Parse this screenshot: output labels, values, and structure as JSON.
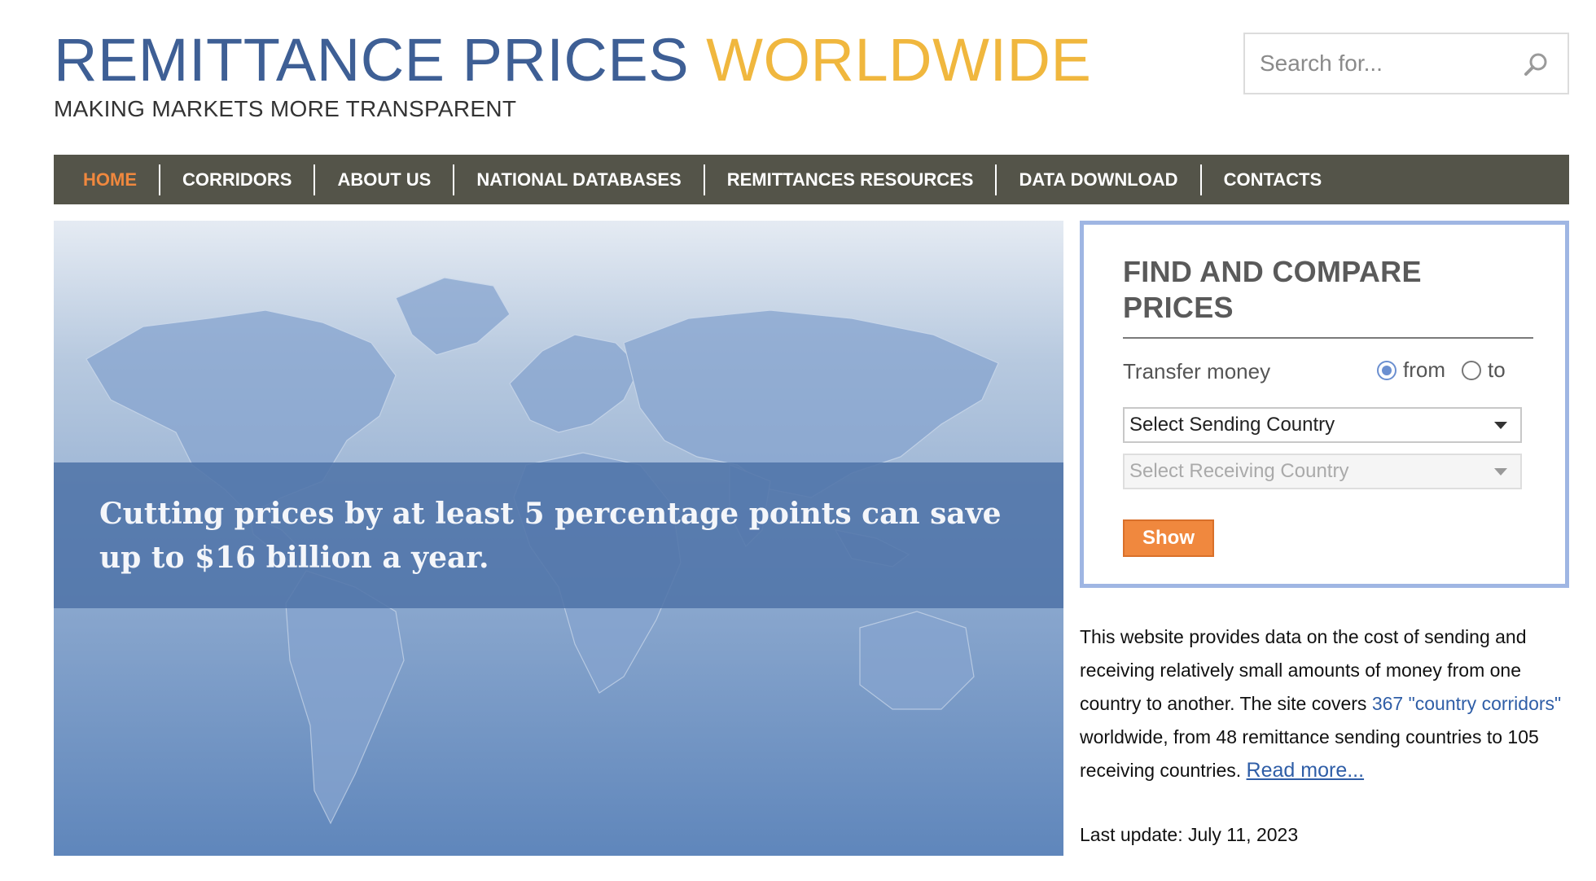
{
  "header": {
    "title_part1": "REMITTANCE PRICES",
    "title_part2": "WORLDWIDE",
    "tagline": "MAKING MARKETS MORE TRANSPARENT",
    "search_placeholder": "Search for...",
    "colors": {
      "title_blue": "#3e5f95",
      "title_gold": "#f0b73e"
    }
  },
  "nav": {
    "items": [
      {
        "label": "HOME",
        "active": true
      },
      {
        "label": "CORRIDORS"
      },
      {
        "label": "ABOUT US"
      },
      {
        "label": "NATIONAL DATABASES"
      },
      {
        "label": "REMITTANCES RESOURCES"
      },
      {
        "label": "DATA DOWNLOAD"
      },
      {
        "label": "CONTACTS"
      }
    ],
    "colors": {
      "bg": "#545449",
      "active": "#f0883e"
    }
  },
  "hero": {
    "text": "Cutting prices by at least 5 percentage points can save up to $16 billion a year."
  },
  "find_panel": {
    "title_line1": "FIND AND COMPARE",
    "title_line2": "PRICES",
    "transfer_label": "Transfer money",
    "radio_from": "from",
    "radio_to": "to",
    "selected_direction": "from",
    "sending_select": "Select Sending Country",
    "receiving_select": "Select Receiving Country",
    "show_button": "Show"
  },
  "description": {
    "part1": "This website provides data on the cost of sending and receiving relatively small amounts of money from one country to another. The site covers",
    "link": "367 \"country corridors\"",
    "part2": "worldwide, from 48 remittance sending countries to 105 receiving countries.",
    "read_more": "Read more..."
  },
  "last_update": "Last update: July 11, 2023"
}
